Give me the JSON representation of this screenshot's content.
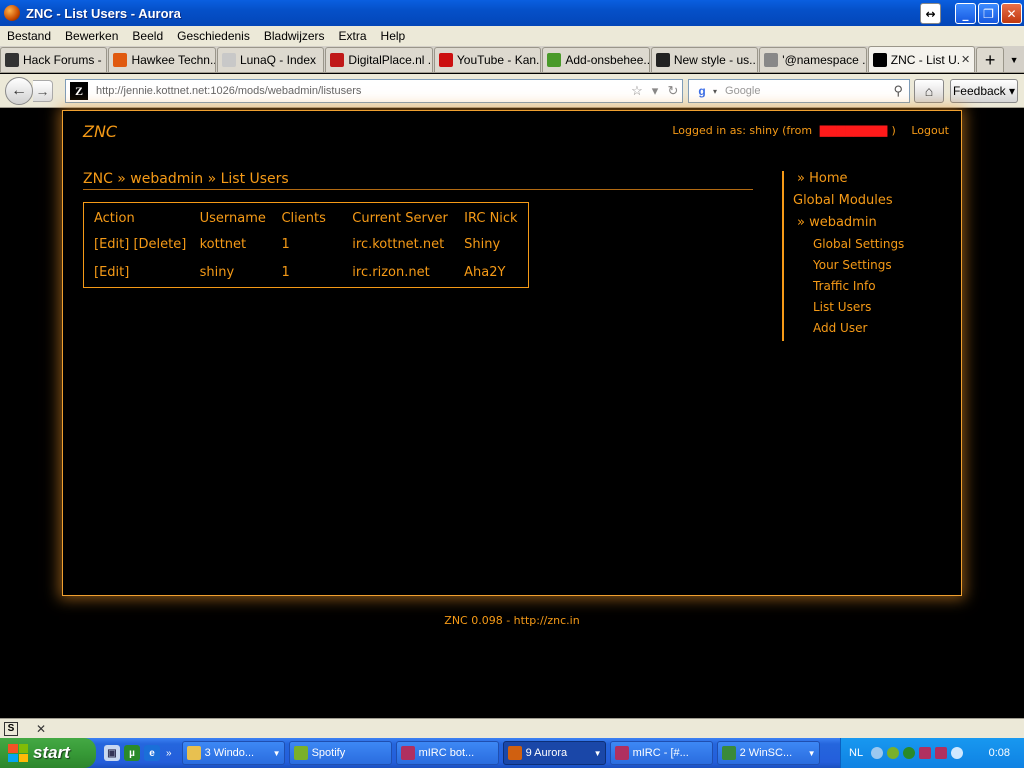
{
  "window": {
    "title": "ZNC - List Users - Aurora"
  },
  "menu": [
    "Bestand",
    "Bewerken",
    "Beeld",
    "Geschiedenis",
    "Bladwijzers",
    "Extra",
    "Help"
  ],
  "tabs": [
    {
      "label": "Hack Forums - ...",
      "icon": "laptop-icon",
      "color": "#333333"
    },
    {
      "label": "Hawkee Techn...",
      "icon": "hawkee-icon",
      "color": "#e05a10"
    },
    {
      "label": "LunaQ - Index",
      "icon": "page-icon",
      "color": "#c8c8c8"
    },
    {
      "label": "DigitalPlace.nl ...",
      "icon": "dp-icon",
      "color": "#c01818"
    },
    {
      "label": "YouTube - Kan...",
      "icon": "youtube-icon",
      "color": "#cc1010"
    },
    {
      "label": "Add-onsbehee...",
      "icon": "puzzle-icon",
      "color": "#4a9a2a"
    },
    {
      "label": "New style - us...",
      "icon": "userstyles-icon",
      "color": "#222222"
    },
    {
      "label": "'@namespace ...",
      "icon": "grid-icon",
      "color": "#888888"
    },
    {
      "label": "ZNC - List U...",
      "icon": "znc-icon",
      "color": "#000000"
    }
  ],
  "nav": {
    "url": "http://jennie.kottnet.net:1026/mods/webadmin/listusers",
    "search_placeholder": "Google",
    "feedback": "Feedback"
  },
  "page": {
    "logo": "ZNC",
    "logged_in_prefix": "Logged in as: shiny (from",
    "logged_in_suffix": ")",
    "logout": "Logout",
    "breadcrumb": "ZNC » webadmin » List Users",
    "table": {
      "headers": [
        "Action",
        "Username",
        "Clients",
        "Current Server",
        "IRC Nick"
      ],
      "rows": [
        {
          "action": "[Edit] [Delete]",
          "username": "kottnet",
          "clients": "1",
          "server": "irc.kottnet.net",
          "nick": "Shiny"
        },
        {
          "action": "[Edit]",
          "username": "shiny",
          "clients": "1",
          "server": "irc.rizon.net",
          "nick": "Aha2Y"
        }
      ]
    },
    "sidebar": {
      "home": "» Home",
      "global_modules": "Global Modules",
      "webadmin": "» webadmin",
      "links": [
        "Global Settings",
        "Your Settings",
        "Traffic Info",
        "List Users",
        "Add User"
      ]
    },
    "footer": "ZNC 0.098 - http://znc.in"
  },
  "taskbar": {
    "start": "start",
    "tasks": [
      {
        "label": "3 Windo...",
        "icon_color": "#e8c050"
      },
      {
        "label": "Spotify",
        "icon_color": "#7ab02a"
      },
      {
        "label": "mIRC bot...",
        "icon_color": "#b03060"
      },
      {
        "label": "9 Aurora",
        "icon_color": "#d06010"
      },
      {
        "label": "mIRC - [#...",
        "icon_color": "#b03060"
      },
      {
        "label": "2 WinSC...",
        "icon_color": "#3a8a3a"
      }
    ],
    "language": "NL",
    "clock": "0:08"
  }
}
